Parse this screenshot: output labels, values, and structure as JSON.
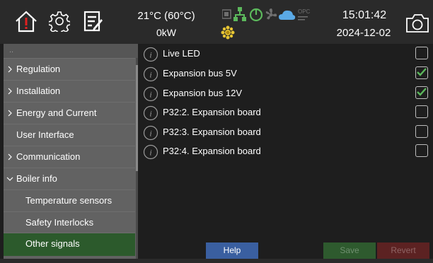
{
  "header": {
    "temperature": "21°C (60°C)",
    "power": "0kW",
    "time": "15:01:42",
    "date": "2024-12-02",
    "status_icon_text": "OPC",
    "icons": [
      "home-alarm-icon",
      "gear-icon",
      "notes-icon",
      "network-icon",
      "power-icon",
      "fan-icon",
      "cloud-icon",
      "sun-icon",
      "camera-icon"
    ]
  },
  "sidebar": {
    "items": [
      {
        "label": "Regulation",
        "expandable": true
      },
      {
        "label": "Installation",
        "expandable": true
      },
      {
        "label": "Energy and Current",
        "expandable": true
      },
      {
        "label": "User Interface",
        "expandable": false
      },
      {
        "label": "Communication",
        "expandable": true
      },
      {
        "label": "Boiler info",
        "expandable": true,
        "expanded": true
      },
      {
        "label": "Temperature sensors",
        "sub": true
      },
      {
        "label": "Safety Interlocks",
        "sub": true
      },
      {
        "label": "Other signals",
        "sub": true,
        "active": true
      }
    ]
  },
  "signals": [
    {
      "label": "Live LED",
      "checked": false
    },
    {
      "label": "Expansion bus 5V",
      "checked": true
    },
    {
      "label": "Expansion bus 12V",
      "checked": true
    },
    {
      "label": "P32:2. Expansion board",
      "checked": false
    },
    {
      "label": "P32:3. Expansion board",
      "checked": false
    },
    {
      "label": "P32:4. Expansion board",
      "checked": false
    }
  ],
  "buttons": {
    "help": "Help",
    "save": "Save",
    "revert": "Revert"
  },
  "colors": {
    "accent_green": "#5cb85c",
    "active_item": "#2c5a2c",
    "help_blue": "#3a5fa0",
    "revert_red": "#5c2222"
  }
}
